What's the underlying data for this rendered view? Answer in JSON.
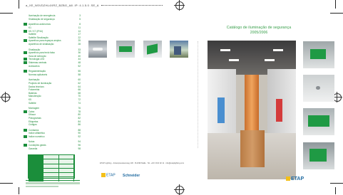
{
  "header": {
    "text": "a_XE_NSVDZHL4XRZ_BZBG_A8 .IP: 4.1.5.0 .SE_A"
  },
  "index": {
    "rows": [
      {
        "label": "Iluminação de emergência",
        "page": "3",
        "marked": false
      },
      {
        "label": "Sinalização de segurança",
        "page": "5",
        "marked": false
      },
      {
        "label": "",
        "page": "",
        "marked": false
      },
      {
        "label": "Aparelhos autónomos",
        "page": "8",
        "marked": true
      },
      {
        "label": "K1",
        "page": "11",
        "marked": false
      },
      {
        "label": "K5 / K7 (IP44)",
        "page": "14",
        "marked": true
      },
      {
        "label": "Safelite",
        "page": "17",
        "marked": false
      },
      {
        "label": "Safelite Sinalização",
        "page": "22",
        "marked": false
      },
      {
        "label": "Aparelhos para espaços amplos",
        "page": "25",
        "marked": true
      },
      {
        "label": "Aparelhos de sinalização",
        "page": "28",
        "marked": false
      },
      {
        "label": "",
        "page": "",
        "marked": false
      },
      {
        "label": "Sinalização",
        "page": "33",
        "marked": false
      },
      {
        "label": "Aparelhos para tecto falso",
        "page": "36",
        "marked": true
      },
      {
        "label": "Guia de selecção",
        "page": "40",
        "marked": false
      },
      {
        "label": "Tecnologia LED",
        "page": "44",
        "marked": true
      },
      {
        "label": "Sistemas centrais",
        "page": "48",
        "marked": true
      },
      {
        "label": "Acessórios",
        "page": "52",
        "marked": false
      },
      {
        "label": "",
        "page": "",
        "marked": false
      },
      {
        "label": "Regulamentação",
        "page": "55",
        "marked": true
      },
      {
        "label": "Normas aplicáveis",
        "page": "58",
        "marked": false
      },
      {
        "label": "",
        "page": "",
        "marked": false
      },
      {
        "label": "Iluminação",
        "page": "60",
        "marked": false
      },
      {
        "label": "Projecto de iluminação",
        "page": "62",
        "marked": false
      },
      {
        "label": "Dados técnicos",
        "page": "64",
        "marked": false
      },
      {
        "label": "Fotometria",
        "page": "66",
        "marked": false
      },
      {
        "label": "Baterias",
        "page": "68",
        "marked": false
      },
      {
        "label": "Manutenção",
        "page": "70",
        "marked": false
      },
      {
        "label": "K5",
        "page": "72",
        "marked": false
      },
      {
        "label": "Safelite",
        "page": "74",
        "marked": false
      },
      {
        "label": "",
        "page": "",
        "marked": false
      },
      {
        "label": "Montagem",
        "page": "76",
        "marked": false
      },
      {
        "label": "Caixa",
        "page": "78",
        "marked": true
      },
      {
        "label": "Difusor",
        "page": "80",
        "marked": false
      },
      {
        "label": "Pictogramas",
        "page": "82",
        "marked": false
      },
      {
        "label": "Etiquetas",
        "page": "84",
        "marked": false
      },
      {
        "label": "Códigos",
        "page": "86",
        "marked": false
      },
      {
        "label": "",
        "page": "",
        "marked": false
      },
      {
        "label": "Contactos",
        "page": "88",
        "marked": true
      },
      {
        "label": "Índice alfabético",
        "page": "90",
        "marked": false
      },
      {
        "label": "Índice numérico",
        "page": "92",
        "marked": true
      },
      {
        "label": "",
        "page": "",
        "marked": false
      },
      {
        "label": "Notas",
        "page": "94",
        "marked": false
      },
      {
        "label": "Condições gerais",
        "page": "96",
        "marked": true
      },
      {
        "label": "Garantia",
        "page": "98",
        "marked": false
      }
    ]
  },
  "cover": {
    "title": "Catálogo de iluminação de segurança",
    "subtitle": "2005/2006",
    "credit": "ETAP Lighting · Antwerpsesteenweg 130 · B-2390 Malle · Tel. +32 3 310 02 11 · info@etaplighting.com",
    "logo_left": "ETAP",
    "logo_partner": "Schneider",
    "logo_right": "ETAP"
  }
}
